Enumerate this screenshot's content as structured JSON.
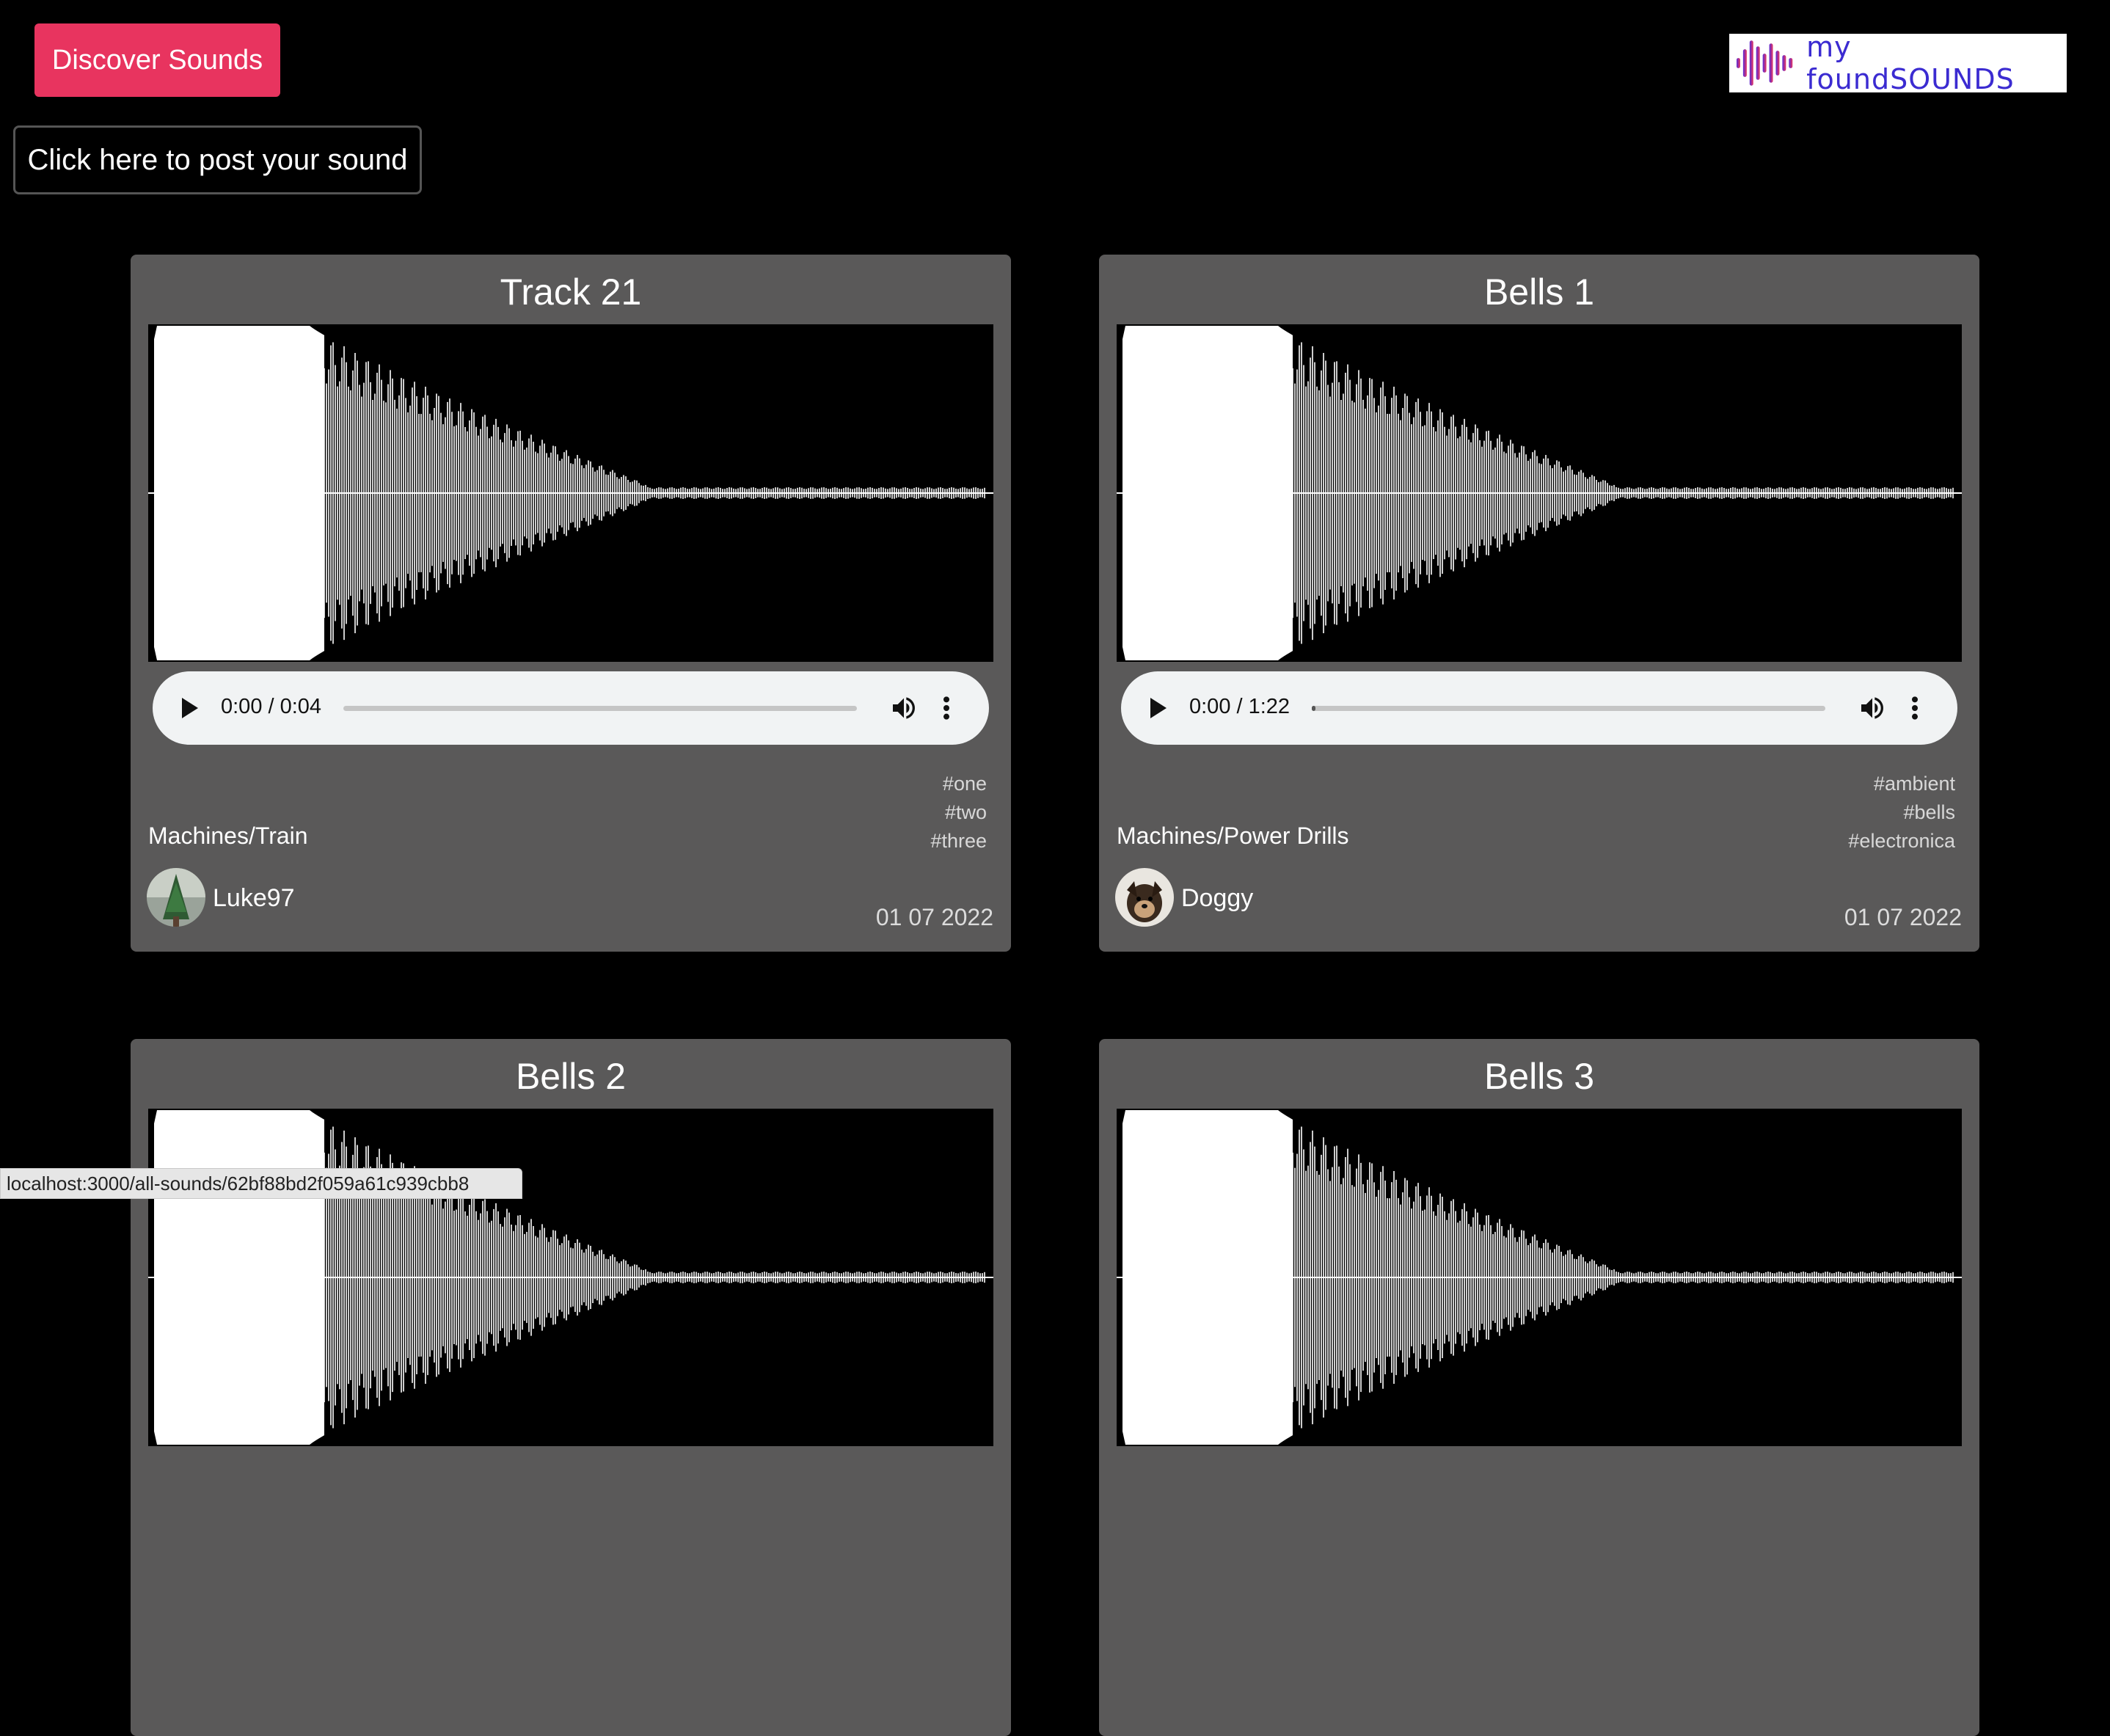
{
  "header": {
    "discover_label": "Discover Sounds",
    "post_label": "Click here to post your sound",
    "logo_text": "my foundSOUNDS"
  },
  "cards": [
    {
      "title": "Track 21",
      "time": "0:00 / 0:04",
      "tags": [
        "#one",
        "#two",
        "#three"
      ],
      "category": "Machines/Train",
      "username": "Luke97",
      "date": "01 07 2022"
    },
    {
      "title": "Bells 1",
      "time": "0:00 / 1:22",
      "tags": [
        "#ambient",
        "#bells",
        "#electronica"
      ],
      "category": "Machines/Power Drills",
      "username": "Doggy",
      "date": "01 07 2022"
    },
    {
      "title": "Bells 2"
    },
    {
      "title": "Bells 3"
    }
  ],
  "status_url": "localhost:3000/all-sounds/62bf88bd2f059a61c939cbb8",
  "colors": {
    "accent": "#e8345f",
    "card_bg": "#5a5959",
    "page_bg": "#000000",
    "logo_text": "#3b2bd1"
  },
  "icons": [
    "play-icon",
    "volume-icon",
    "more-options-icon",
    "sound-wave-logo-icon"
  ]
}
